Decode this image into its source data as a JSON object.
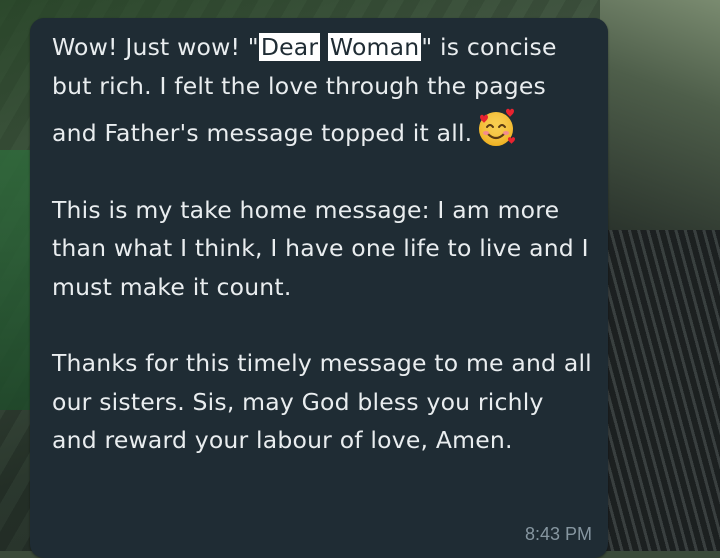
{
  "message": {
    "p1_a": "Wow! Just wow! \"",
    "hl1": "Dear",
    "hl2": "Woman",
    "p1_b": "\" is concise but rich. I felt the love through the pages and Father's message topped it all.",
    "emoji": "smiling-face-with-hearts",
    "p2": "This is my take home message: I am more than what I think, I have one life to live and I must make it count.",
    "p3": "Thanks for this timely message to me and all our sisters. Sis, may God bless you richly and reward your labour of love, Amen.",
    "time": "8:43 PM"
  },
  "colors": {
    "bubble": "#1f2c34",
    "text": "#e9edef",
    "timestamp": "#8696a0",
    "highlight": "#ffffff"
  }
}
